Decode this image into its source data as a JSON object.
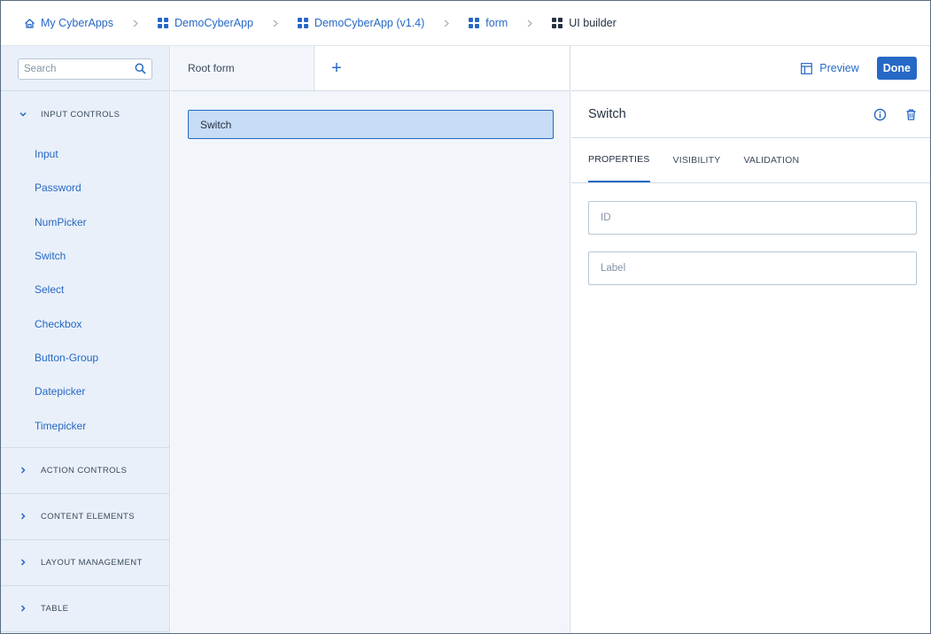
{
  "breadcrumbs": [
    {
      "label": "My CyberApps",
      "icon": "home-icon"
    },
    {
      "label": "DemoCyberApp",
      "icon": "apps-grid-icon"
    },
    {
      "label": "DemoCyberApp (v1.4)",
      "icon": "apps-grid-icon"
    },
    {
      "label": "form",
      "icon": "apps-grid-icon"
    },
    {
      "label": "UI builder",
      "icon": "apps-grid-icon"
    }
  ],
  "sidebar": {
    "search": {
      "placeholder": "Search"
    },
    "sections": [
      {
        "label": "INPUT CONTROLS",
        "expanded": true
      },
      {
        "label": "ACTION CONTROLS",
        "expanded": false
      },
      {
        "label": "CONTENT ELEMENTS",
        "expanded": false
      },
      {
        "label": "LAYOUT MANAGEMENT",
        "expanded": false
      },
      {
        "label": "TABLE",
        "expanded": false
      }
    ],
    "input_controls": [
      "Input",
      "Password",
      "NumPicker",
      "Switch",
      "Select",
      "Checkbox",
      "Button-Group",
      "Datepicker",
      "Timepicker"
    ]
  },
  "canvas": {
    "tab_root": "Root form",
    "add_tab": "+",
    "selected_element": "Switch"
  },
  "panel": {
    "preview_label": "Preview",
    "done_label": "Done",
    "title": "Switch",
    "tabs": [
      "PROPERTIES",
      "VISIBILITY",
      "VALIDATION"
    ],
    "active_tab": "PROPERTIES",
    "fields": {
      "id_placeholder": "ID",
      "label_placeholder": "Label"
    }
  },
  "colors": {
    "accent": "#2668c5",
    "sidebar_bg": "#e9f0f9",
    "canvas_bg": "#f2f6fb",
    "selected_bg": "#c7dcf5"
  }
}
